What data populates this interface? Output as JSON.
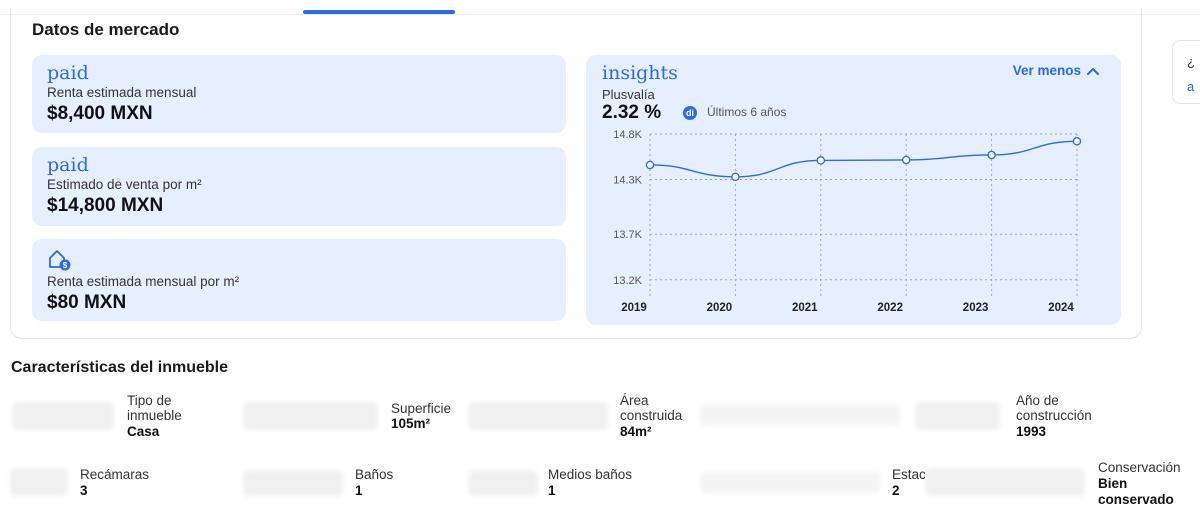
{
  "market": {
    "title": "Datos de mercado",
    "cards": [
      {
        "brand": "paid",
        "label": "Renta estimada mensual",
        "value": "$8,400 MXN"
      },
      {
        "brand": "paid",
        "label": "Estimado de venta por m²",
        "value": "$14,800 MXN"
      },
      {
        "icon": "house-price-icon",
        "label": "Renta estimada mensual por m²",
        "value": "$80 MXN"
      }
    ],
    "insights": {
      "brand": "insights",
      "toggle_label": "Ver menos",
      "metric_label": "Plusvalía",
      "metric_value": "2.32 %",
      "period": "Últimos 6 años",
      "badge": "di"
    }
  },
  "side_peek": {
    "q": "¿",
    "a": "a"
  },
  "chart_data": {
    "type": "line",
    "x": [
      "2019",
      "2020",
      "2021",
      "2022",
      "2023",
      "2024"
    ],
    "series": [
      {
        "values": [
          14460,
          14330,
          14510,
          14515,
          14570,
          14720
        ]
      }
    ],
    "ylim": [
      13000,
      14800
    ],
    "yticks": [
      "14.8K",
      "14.3K",
      "13.7K",
      "13.2K"
    ],
    "ytick_values": [
      14800,
      14300,
      13700,
      13200
    ],
    "grid": true,
    "color": "#2b6be3"
  },
  "features": {
    "title": "Características del inmueble",
    "items": [
      {
        "label": "Tipo de inmueble",
        "value": "Casa"
      },
      {
        "label": "Superficie",
        "value": "105m²"
      },
      {
        "label": "Área construida",
        "value": "84m²"
      },
      {
        "label": "Año de construcción",
        "value": "1993"
      },
      {
        "label": "Recámaras",
        "value": "3"
      },
      {
        "label": "Baños",
        "value": "1"
      },
      {
        "label": "Medios baños",
        "value": "1"
      },
      {
        "label": "Estacionamientos",
        "value": "2"
      },
      {
        "label": "Conservación",
        "value": "Bien conservado"
      }
    ]
  },
  "colors": {
    "accent": "#2b6be3",
    "card_bg": "#e6efff"
  }
}
